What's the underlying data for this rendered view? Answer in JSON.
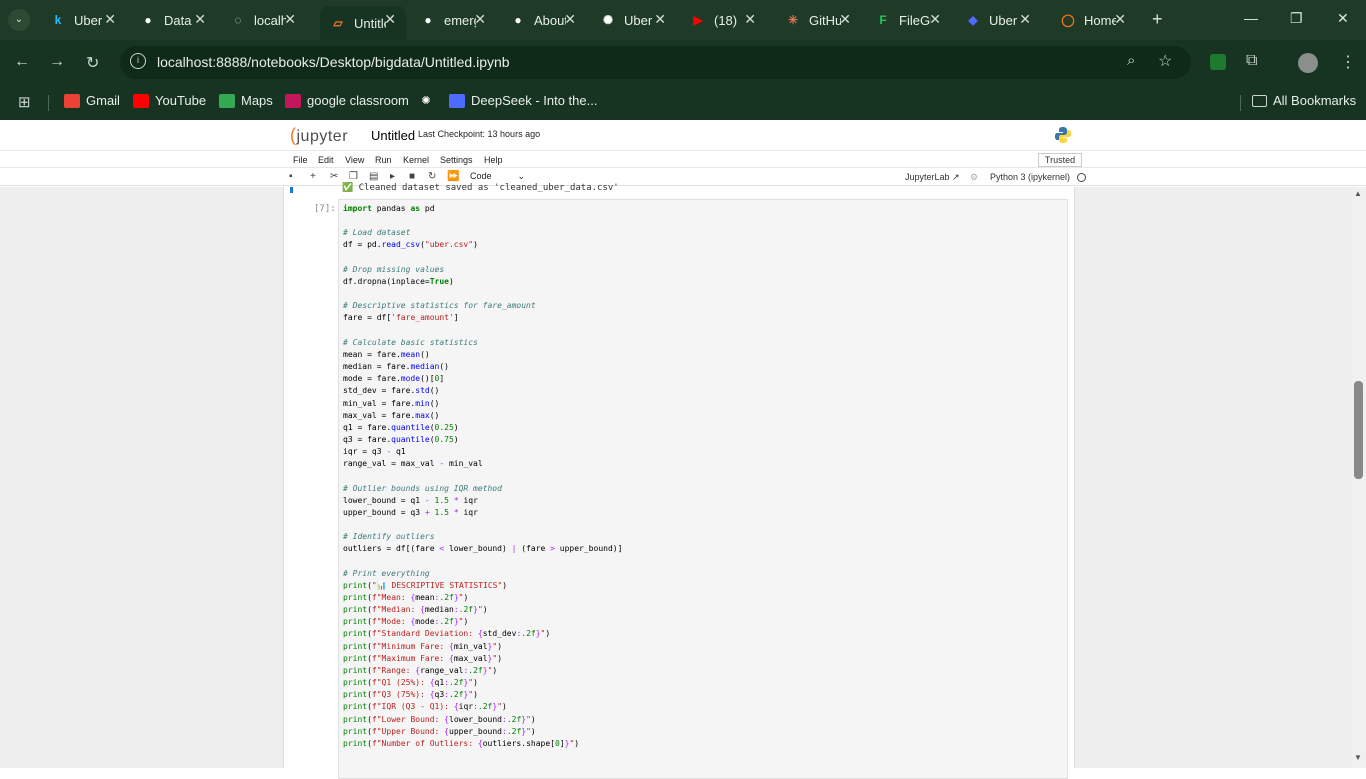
{
  "tabs": [
    {
      "title": "Uber Data Analysis",
      "icon": "kaggle-icon",
      "icon_char": "k",
      "icon_color": "#20beff"
    },
    {
      "title": "Data",
      "icon": "github-icon",
      "icon_char": "●",
      "icon_color": "#ffffff"
    },
    {
      "title": "localhost",
      "icon": "loading-icon",
      "icon_char": "◌",
      "icon_color": "#cfd8d2"
    },
    {
      "title": "Untitled",
      "icon": "jupyter-icon",
      "icon_char": "▱",
      "icon_color": "#f37726"
    },
    {
      "title": "emerging",
      "icon": "github-icon",
      "icon_char": "●",
      "icon_color": "#ffffff"
    },
    {
      "title": "About",
      "icon": "github-icon",
      "icon_char": "●",
      "icon_color": "#ffffff"
    },
    {
      "title": "Uber",
      "icon": "openai-icon",
      "icon_char": "✺",
      "icon_color": "#ffffff"
    },
    {
      "title": "(18)",
      "icon": "youtube-icon",
      "icon_char": "▶",
      "icon_color": "#ff0000"
    },
    {
      "title": "GitHub",
      "icon": "claude-icon",
      "icon_char": "✳",
      "icon_color": "#d97757"
    },
    {
      "title": "FileGuru",
      "icon": "file-icon",
      "icon_char": "F",
      "icon_color": "#22c55e"
    },
    {
      "title": "Uber",
      "icon": "deepseek-icon",
      "icon_char": "◆",
      "icon_color": "#4d6bfe"
    },
    {
      "title": "Home",
      "icon": "loading-icon",
      "icon_char": "◯",
      "icon_color": "#f97316"
    }
  ],
  "address": {
    "url": "localhost:8888/notebooks/Desktop/bigdata/Untitled.ipynb"
  },
  "bookmarks": {
    "apps_icon": "apps-grid-icon",
    "items": [
      {
        "label": "Gmail",
        "icon": "gmail-icon",
        "color": "#ea4335"
      },
      {
        "label": "YouTube",
        "icon": "youtube-icon",
        "color": "#ff0000"
      },
      {
        "label": "Maps",
        "icon": "maps-icon",
        "color": "#34a853"
      },
      {
        "label": "google classroom",
        "icon": "classroom-icon",
        "color": "#c2185b"
      },
      {
        "label": "",
        "icon": "openai-icon",
        "color": "#ffffff"
      },
      {
        "label": "DeepSeek - Into the...",
        "icon": "deepseek-icon",
        "color": "#4d6bfe"
      }
    ],
    "all_bookmarks": "All Bookmarks"
  },
  "jupyter": {
    "logo": "jupyter",
    "notebook_name": "Untitled",
    "checkpoint": "Last Checkpoint: 13 hours ago",
    "menus": [
      "File",
      "Edit",
      "View",
      "Run",
      "Kernel",
      "Settings",
      "Help"
    ],
    "trusted": "Trusted",
    "cell_type": "Code",
    "jupyterlab_label": "JupyterLab",
    "kernel": "Python 3 (ipykernel)"
  },
  "cell": {
    "prev_output": "✅ Cleaned dataset saved as 'cleaned_uber_data.csv'",
    "prompt": "[7]:"
  }
}
